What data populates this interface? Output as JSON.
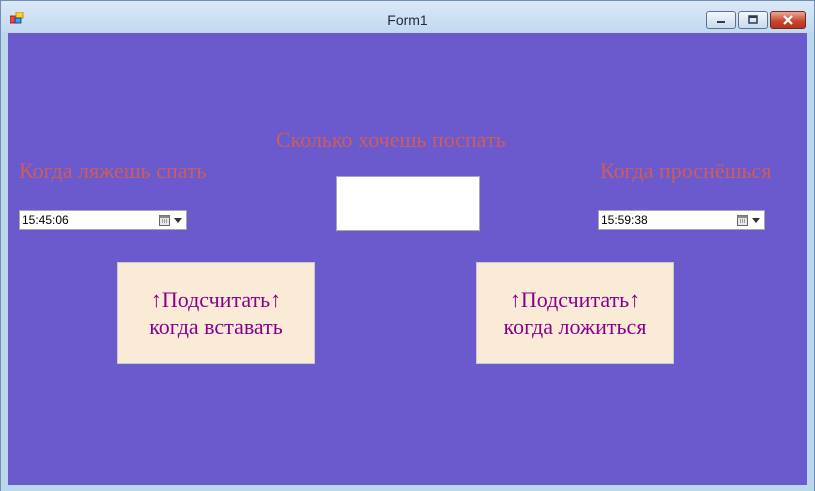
{
  "window": {
    "title": "Form1",
    "icon": "winforms-app-icon",
    "controls": {
      "minimize": "minimize-icon",
      "maximize": "maximize-icon",
      "close": "close-icon"
    }
  },
  "colors": {
    "form_background": "#6a5acd",
    "label_color": "#cd5c5c",
    "button_background": "#faebd7",
    "button_text": "#8b008b"
  },
  "labels": {
    "sleep_duration": "Сколько хочешь поспать",
    "bedtime": "Когда ляжешь спать",
    "wakeup": "Когда проснёшься"
  },
  "bedtime_picker": {
    "value": "15:45:06",
    "icon": "calendar-icon"
  },
  "wakeup_picker": {
    "value": "15:59:38",
    "icon": "calendar-icon"
  },
  "sleep_duration_input": {
    "value": ""
  },
  "buttons": {
    "calc_wakeup": {
      "line1": "↑Подсчитать↑",
      "line2": "когда вставать"
    },
    "calc_bedtime": {
      "line1": "↑Подсчитать↑",
      "line2": "когда ложиться"
    }
  }
}
